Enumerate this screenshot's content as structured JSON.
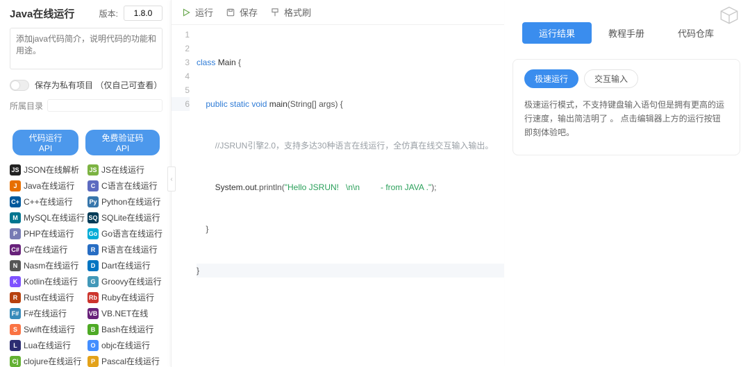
{
  "header": {
    "title": "Java在线运行",
    "version_label": "版本:",
    "version_value": "1.8.0"
  },
  "desc_placeholder": "添加java代码简介，说明代码的功能和用途。",
  "private": {
    "label": "保存为私有项目 （仅自己可查看）"
  },
  "directory": {
    "label": "所属目录"
  },
  "api_pills": {
    "run": "代码运行API",
    "captcha": "免费验证码API"
  },
  "langs": [
    {
      "label": "JSON在线解析",
      "bg": "#222",
      "abbr": "JS"
    },
    {
      "label": "JS在线运行",
      "bg": "#7cb342",
      "abbr": "JS"
    },
    {
      "label": "Java在线运行",
      "bg": "#e76f00",
      "abbr": "J"
    },
    {
      "label": "C语言在线运行",
      "bg": "#5c6bc0",
      "abbr": "C"
    },
    {
      "label": "C++在线运行",
      "bg": "#00599c",
      "abbr": "C+"
    },
    {
      "label": "Python在线运行",
      "bg": "#3776ab",
      "abbr": "Py"
    },
    {
      "label": "MySQL在线运行",
      "bg": "#00758f",
      "abbr": "M"
    },
    {
      "label": "SQLite在线运行",
      "bg": "#003b57",
      "abbr": "SQ"
    },
    {
      "label": "PHP在线运行",
      "bg": "#777bb4",
      "abbr": "P"
    },
    {
      "label": "Go语言在线运行",
      "bg": "#00acd7",
      "abbr": "Go"
    },
    {
      "label": "C#在线运行",
      "bg": "#68217a",
      "abbr": "C#"
    },
    {
      "label": "R语言在线运行",
      "bg": "#276dc3",
      "abbr": "R"
    },
    {
      "label": "Nasm在线运行",
      "bg": "#555",
      "abbr": "N"
    },
    {
      "label": "Dart在线运行",
      "bg": "#0175c2",
      "abbr": "D"
    },
    {
      "label": "Kotlin在线运行",
      "bg": "#7f52ff",
      "abbr": "K"
    },
    {
      "label": "Groovy在线运行",
      "bg": "#4298b8",
      "abbr": "G"
    },
    {
      "label": "Rust在线运行",
      "bg": "#b7410e",
      "abbr": "R"
    },
    {
      "label": "Ruby在线运行",
      "bg": "#cc342d",
      "abbr": "Rb"
    },
    {
      "label": "F#在线运行",
      "bg": "#378bba",
      "abbr": "F#"
    },
    {
      "label": "VB.NET在线",
      "bg": "#68217a",
      "abbr": "VB"
    },
    {
      "label": "Swift在线运行",
      "bg": "#fa7343",
      "abbr": "S"
    },
    {
      "label": "Bash在线运行",
      "bg": "#4eaa25",
      "abbr": "B"
    },
    {
      "label": "Lua在线运行",
      "bg": "#2c2d72",
      "abbr": "L"
    },
    {
      "label": "objc在线运行",
      "bg": "#438eff",
      "abbr": "O"
    },
    {
      "label": "clojure在线运行",
      "bg": "#63b132",
      "abbr": "Cj"
    },
    {
      "label": "Pascal在线运行",
      "bg": "#e3a21a",
      "abbr": "P"
    }
  ],
  "toolbar": {
    "run": "运行",
    "save": "保存",
    "format": "格式刷"
  },
  "editor": {
    "line_numbers": [
      "1",
      "2",
      "3",
      "4",
      "5",
      "6"
    ],
    "code_tokens": {
      "l1": {
        "kw1": "class",
        "name": "Main",
        "brace": "{"
      },
      "l2": {
        "kw": "public static void",
        "fn": "main",
        "args": "(String[] args) {"
      },
      "l3": {
        "text": "//JSRUN引擎2.0，支持多达30种语言在线运行，全仿真在线交互输入输出。"
      },
      "l4": {
        "obj": "System.out",
        "call": ".println(",
        "str": "\"Hello JSRUN!   \\n\\n         - from JAVA .\"",
        "end": ");"
      },
      "l5": {
        "text": "}"
      },
      "l6": {
        "text": "}"
      }
    }
  },
  "right": {
    "tabs": {
      "result": "运行结果",
      "manual": "教程手册",
      "repo": "代码仓库"
    },
    "subtabs": {
      "fast": "极速运行",
      "interactive": "交互输入"
    },
    "text1": "极速运行模式，不支持键盘输入语句但是拥有更高的运行速度，输出简洁明了 。  点击编辑器上方的运行按钮即刻体验吧。"
  },
  "collapse_glyph": "‹"
}
